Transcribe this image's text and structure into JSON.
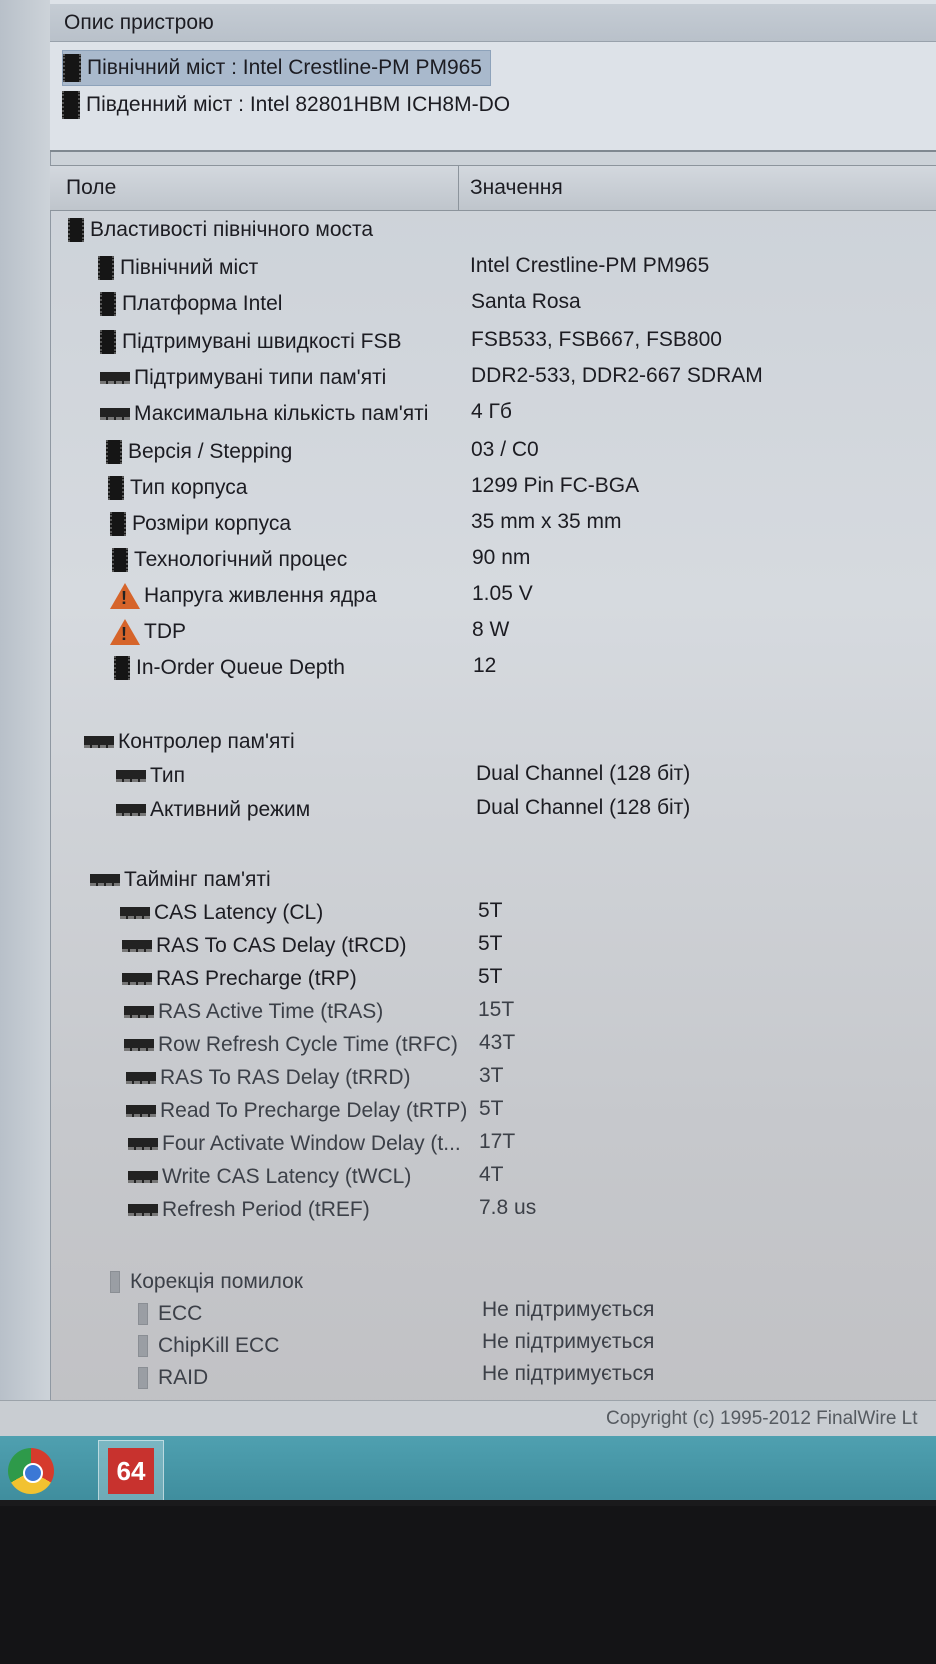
{
  "device_description": {
    "title": "Опис пристрою",
    "items": [
      {
        "label": "Північний міст : Intel Crestline-PM PM965"
      },
      {
        "label": "Південний міст : Intel 82801HBM ICH8M-DO"
      }
    ]
  },
  "columns": {
    "field": "Поле",
    "value": "Значення"
  },
  "northbridge": {
    "group_label": "Властивості північного моста",
    "rows": [
      {
        "field": "Північний міст",
        "value": "Intel Crestline-PM PM965",
        "icon": "chip-icon"
      },
      {
        "field": "Платформа Intel",
        "value": "Santa Rosa",
        "icon": "chip-icon"
      },
      {
        "field": "Підтримувані швидкості FSB",
        "value": "FSB533, FSB667, FSB800",
        "icon": "chip-icon"
      },
      {
        "field": "Підтримувані типи пам'яті",
        "value": "DDR2-533, DDR2-667 SDRAM",
        "icon": "memory-icon"
      },
      {
        "field": "Максимальна кількість пам'яті",
        "value": "4 Гб",
        "icon": "memory-icon"
      },
      {
        "field": "Версія / Stepping",
        "value": "03 / C0",
        "icon": "chip-icon"
      },
      {
        "field": "Тип корпуса",
        "value": "1299 Pin FC-BGA",
        "icon": "chip-icon"
      },
      {
        "field": "Розміри корпуса",
        "value": "35 mm x 35 mm",
        "icon": "chip-icon"
      },
      {
        "field": "Технологічний процес",
        "value": "90 nm",
        "icon": "chip-icon"
      },
      {
        "field": "Напруга живлення ядра",
        "value": "1.05 V",
        "icon": "warning-icon"
      },
      {
        "field": "TDP",
        "value": "8 W",
        "icon": "warning-icon"
      },
      {
        "field": "In-Order Queue Depth",
        "value": "12",
        "icon": "chip-icon"
      }
    ]
  },
  "memory_controller": {
    "group_label": "Контролер пам'яті",
    "rows": [
      {
        "field": "Тип",
        "value": "Dual Channel  (128 біт)"
      },
      {
        "field": "Активний режим",
        "value": "Dual Channel  (128 біт)"
      }
    ]
  },
  "memory_timing": {
    "group_label": "Таймінг пам'яті",
    "rows": [
      {
        "field": "CAS Latency (CL)",
        "value": "5T"
      },
      {
        "field": "RAS To CAS Delay (tRCD)",
        "value": "5T"
      },
      {
        "field": "RAS Precharge (tRP)",
        "value": "5T"
      },
      {
        "field": "RAS Active Time (tRAS)",
        "value": "15T"
      },
      {
        "field": "Row Refresh Cycle Time (tRFC)",
        "value": "43T"
      },
      {
        "field": "RAS To RAS Delay (tRRD)",
        "value": "3T"
      },
      {
        "field": "Read To Precharge Delay (tRTP)",
        "value": "5T"
      },
      {
        "field": "Four Activate Window Delay (t...",
        "value": "17T"
      },
      {
        "field": "Write CAS Latency (tWCL)",
        "value": "4T"
      },
      {
        "field": "Refresh Period (tREF)",
        "value": "7.8 us"
      }
    ]
  },
  "error_correction": {
    "group_label": "Корекція помилок",
    "rows": [
      {
        "field": "ECC",
        "value": "Не підтримується"
      },
      {
        "field": "ChipKill ECC",
        "value": "Не підтримується"
      },
      {
        "field": "RAID",
        "value": "Не підтримується"
      }
    ]
  },
  "status_bar": {
    "copyright": "Copyright (c) 1995-2012 FinalWire Lt"
  },
  "taskbar": {
    "app_label": "64"
  }
}
